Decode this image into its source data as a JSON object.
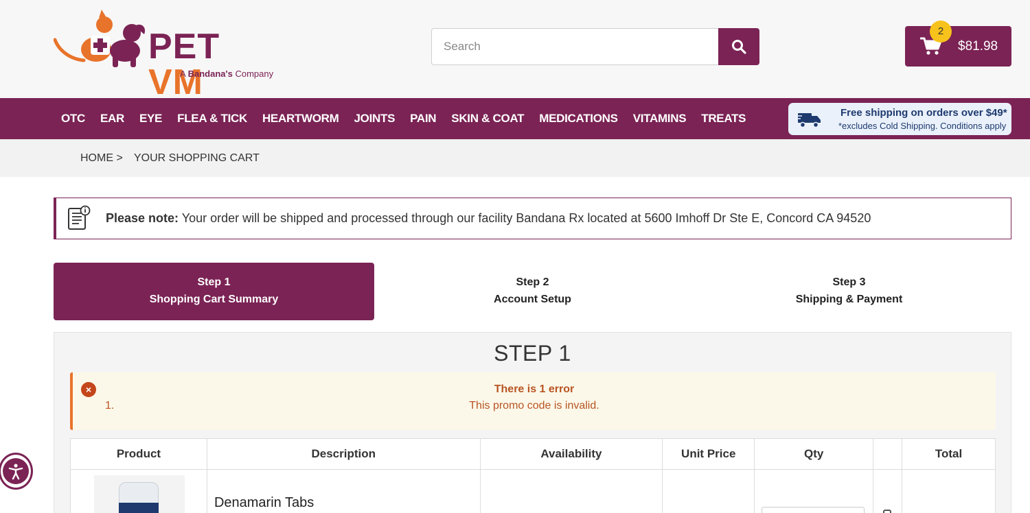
{
  "brand": {
    "name_part1": "PET",
    "name_part2": "VM",
    "tagline_prefix": "A",
    "tagline_brand": "Bandana's",
    "tagline_suffix": "Company"
  },
  "search": {
    "placeholder": "Search"
  },
  "cart": {
    "count": "2",
    "total": "$81.98"
  },
  "nav": {
    "items": [
      "OTC",
      "EAR",
      "EYE",
      "FLEA & TICK",
      "HEARTWORM",
      "JOINTS",
      "PAIN",
      "SKIN & COAT",
      "MEDICATIONS",
      "VITAMINS",
      "TREATS"
    ]
  },
  "shipping_banner": {
    "title": "Free shipping on orders over $49*",
    "note": "*excludes Cold Shipping. Conditions apply"
  },
  "breadcrumb": {
    "home": "HOME >",
    "current": "YOUR SHOPPING CART"
  },
  "notice": {
    "label": "Please note:",
    "text": " Your order will be shipped and processed through our facility Bandana Rx located at 5600 Imhoff Dr Ste E, Concord CA 94520"
  },
  "steps": [
    {
      "number": "Step 1",
      "label": "Shopping Cart Summary",
      "active": true
    },
    {
      "number": "Step 2",
      "label": "Account Setup",
      "active": false
    },
    {
      "number": "Step 3",
      "label": "Shipping & Payment",
      "active": false
    }
  ],
  "panel": {
    "title": "STEP 1"
  },
  "error": {
    "title": "There is 1 error",
    "number": "1.",
    "message": "This promo code is invalid."
  },
  "table": {
    "headers": [
      "Product",
      "Description",
      "Availability",
      "Unit Price",
      "Qty",
      "",
      "Total"
    ],
    "rows": [
      {
        "description": "Denamarin Tabs"
      }
    ]
  },
  "colors": {
    "brand_plum": "#7b2355",
    "brand_orange": "#e8732a",
    "badge_yellow": "#f6c21b",
    "error_text": "#b85422",
    "error_bg": "#fcf8e9"
  }
}
